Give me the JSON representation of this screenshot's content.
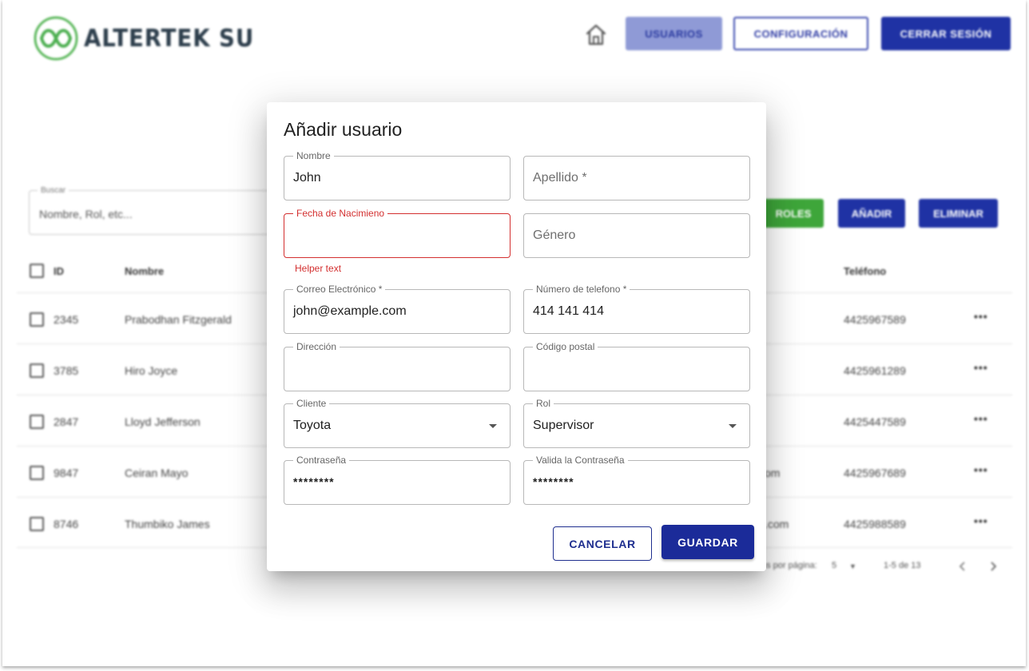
{
  "header": {
    "logo_text": "ALTERTEK SU",
    "nav": {
      "usuarios": "USUARIOS",
      "configuracion": "CONFIGURACIÓN",
      "cerrar_sesion": "CERRAR SESIÓN"
    }
  },
  "toolbar": {
    "search_label": "Buscar",
    "search_placeholder": "Nombre, Rol, etc...",
    "roles": "ROLES",
    "anadir": "AÑADIR",
    "eliminar": "ELIMINAR"
  },
  "table": {
    "headers": {
      "id": "ID",
      "nombre": "Nombre",
      "telefono": "Teléfono"
    },
    "rows": [
      {
        "id": "2345",
        "nombre": "Prabodhan Fitzgerald",
        "email_tail": "",
        "telefono": "4425967589"
      },
      {
        "id": "3785",
        "nombre": "Hiro Joyce",
        "email_tail": "",
        "telefono": "4425961289"
      },
      {
        "id": "2847",
        "nombre": "Lloyd Jefferson",
        "email_tail": "",
        "telefono": "4425447589"
      },
      {
        "id": "9847",
        "nombre": "Ceiran Mayo",
        "email_tail": "om",
        "telefono": "4425967689"
      },
      {
        "id": "8746",
        "nombre": "Thumbiko James",
        "email_tail": ".com",
        "telefono": "4425988589"
      }
    ],
    "row_menu": "•••",
    "pagination": {
      "rows_label": "as por página:",
      "rows_value": "5",
      "range": "1-5 de 13"
    }
  },
  "dialog": {
    "title": "Añadir usuario",
    "nombre": {
      "label": "Nombre",
      "value": "John"
    },
    "apellido": {
      "placeholder": "Apellido *"
    },
    "fecha": {
      "label": "Fecha de Nacimieno",
      "value": "",
      "helper": "Helper text"
    },
    "genero": {
      "placeholder": "Género"
    },
    "correo": {
      "label": "Correo Electrónico *",
      "value": "john@example.com"
    },
    "telefono": {
      "label": "Número de telefono *",
      "value": "414 141 414"
    },
    "direccion": {
      "label": "Dirección",
      "value": ""
    },
    "codigo_postal": {
      "label": "Código postal",
      "value": ""
    },
    "cliente": {
      "label": "Cliente",
      "value": "Toyota"
    },
    "rol": {
      "label": "Rol",
      "value": "Supervisor"
    },
    "contrasena": {
      "label": "Contraseña",
      "value": "********"
    },
    "valida_contrasena": {
      "label": "Valida la Contraseña",
      "value": "********"
    },
    "cancel": "CANCELAR",
    "save": "GUARDAR"
  },
  "colors": {
    "primary": "#1f32a4",
    "error": "#d32f2f",
    "success": "#3ea63a",
    "logo_green": "#5cb85c"
  }
}
